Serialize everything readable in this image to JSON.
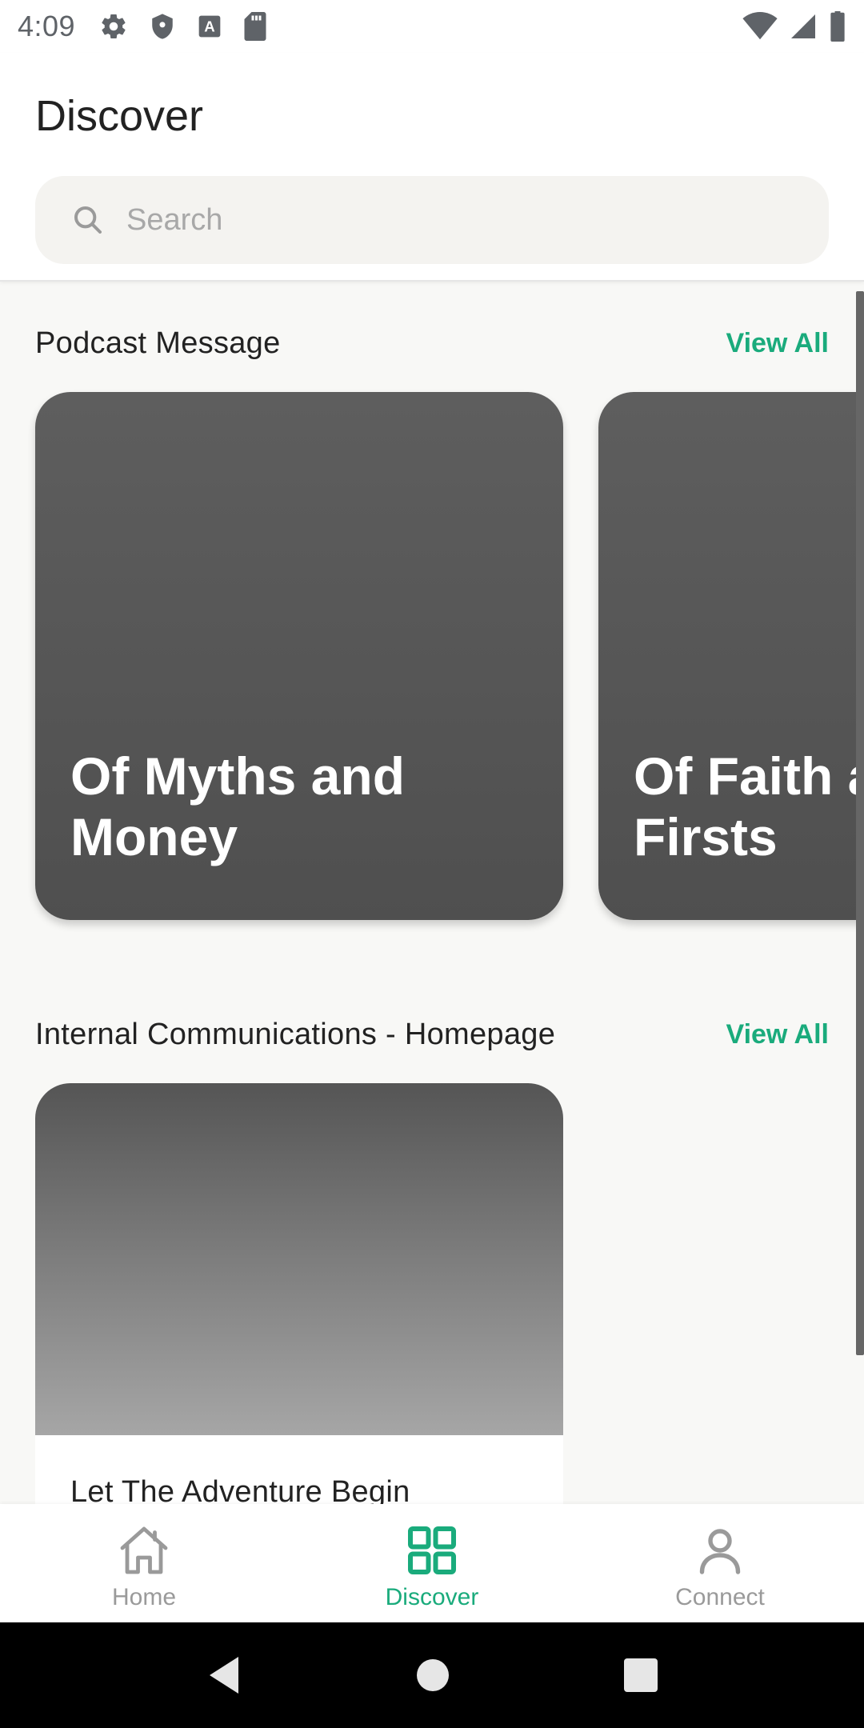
{
  "status_bar": {
    "time": "4:09",
    "left_icons": [
      "gear-icon",
      "shield-icon",
      "a-icon",
      "sd-card-icon"
    ],
    "right_icons": [
      "wifi-icon",
      "signal-icon",
      "battery-icon"
    ]
  },
  "header": {
    "title": "Discover",
    "search_placeholder": "Search"
  },
  "sections": [
    {
      "title": "Podcast Message",
      "view_all": "View All",
      "cards": [
        {
          "title": "Of Myths and Money"
        },
        {
          "title": "Of Faith and Firsts"
        }
      ]
    },
    {
      "title": "Internal Communications - Homepage",
      "view_all": "View All",
      "cards": [
        {
          "title": "Let The Adventure Begin"
        }
      ]
    }
  ],
  "bottom_nav": {
    "items": [
      {
        "label": "Home",
        "icon": "home-icon",
        "active": false
      },
      {
        "label": "Discover",
        "icon": "grid-icon",
        "active": true
      },
      {
        "label": "Connect",
        "icon": "person-icon",
        "active": false
      }
    ]
  },
  "colors": {
    "accent": "#1aab7c",
    "card_bg": "#555555",
    "page_bg": "#f8f8f6"
  }
}
